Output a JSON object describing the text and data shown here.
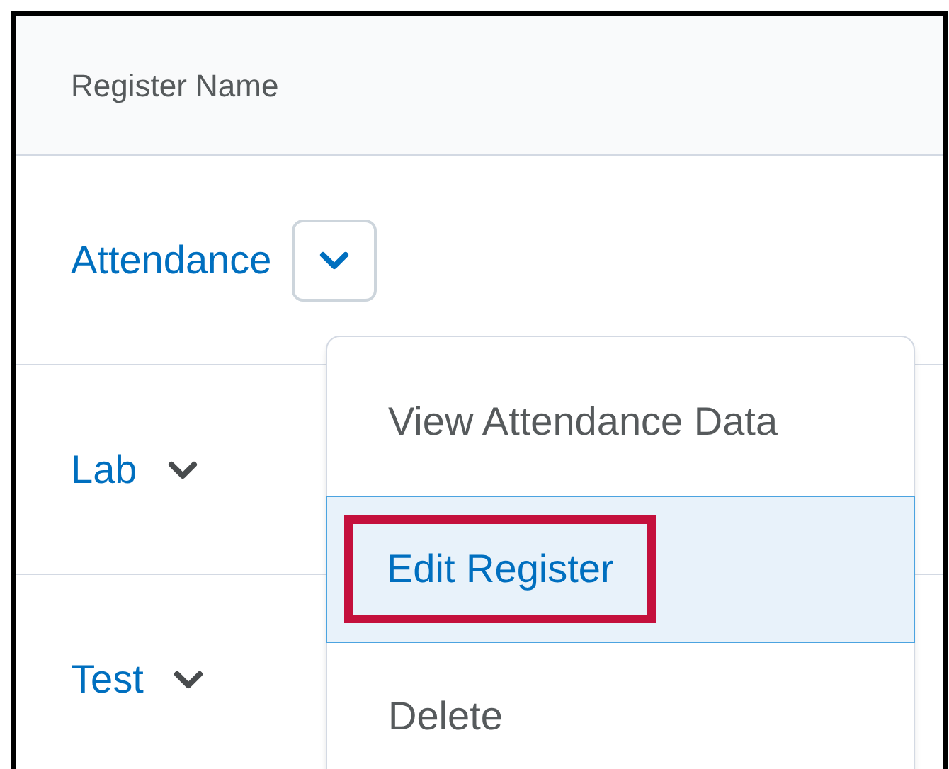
{
  "table": {
    "columns": [
      "Register Name"
    ],
    "rows": [
      {
        "name": "Attendance",
        "expanded": true
      },
      {
        "name": "Lab",
        "expanded": false
      },
      {
        "name": "Test",
        "expanded": false
      }
    ]
  },
  "menu": {
    "items": [
      {
        "label": "View Attendance Data",
        "selected": false,
        "annotated": false
      },
      {
        "label": "Edit Register",
        "selected": true,
        "annotated": true
      },
      {
        "label": "Delete",
        "selected": false,
        "annotated": false
      }
    ]
  }
}
